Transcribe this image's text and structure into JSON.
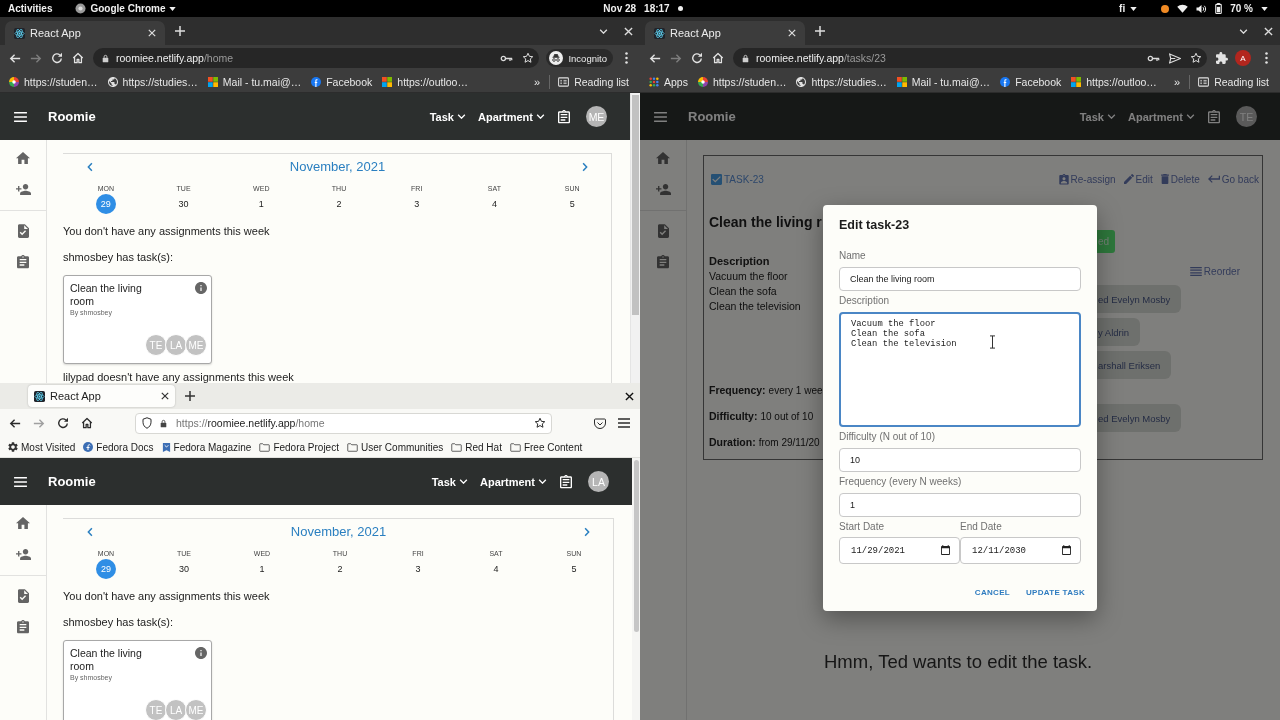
{
  "top_bar": {
    "activities": "Activities",
    "app_menu": "Google Chrome",
    "date": "Nov 28",
    "time": "18:17",
    "keyboard": "fi",
    "battery": "70 %"
  },
  "left_top_window": {
    "kind": "chrome",
    "tabs": [
      {
        "title": "React App",
        "selected": true
      }
    ],
    "url_host": "roomiee.netlify.app",
    "url_path": "/home",
    "omnibox_actions": [
      {
        "kind": "key"
      },
      {
        "kind": "star"
      }
    ],
    "toolbar_items": [
      {
        "kind": "incognito",
        "label": "Incognito"
      }
    ],
    "bookmarks": [
      {
        "kind": "pinwheel",
        "label": "https://studen…"
      },
      {
        "kind": "globe",
        "label": "https://studies…"
      },
      {
        "kind": "windows",
        "label": "Mail - tu.mai@…"
      },
      {
        "kind": "facebook",
        "label": "Facebook"
      },
      {
        "kind": "windows",
        "label": "https://outloo…"
      }
    ],
    "bookmark_overflow": "»",
    "reading_list": "Reading list",
    "page": {
      "kind": "home",
      "brand": "Roomie",
      "menus": [
        "Task",
        "Apartment"
      ],
      "avatar": "ME",
      "calendar": {
        "month": "November, 2021",
        "days": [
          {
            "weekday": "MON",
            "date": "29",
            "selected": true
          },
          {
            "weekday": "TUE",
            "date": "30",
            "selected": false
          },
          {
            "weekday": "WED",
            "date": "1",
            "selected": false
          },
          {
            "weekday": "THU",
            "date": "2",
            "selected": false
          },
          {
            "weekday": "FRI",
            "date": "3",
            "selected": false
          },
          {
            "weekday": "SAT",
            "date": "4",
            "selected": false
          },
          {
            "weekday": "SUN",
            "date": "5",
            "selected": false
          }
        ]
      },
      "note": "You don't have any assignments this week",
      "groups": [
        {
          "heading": "shmosbey has task(s):",
          "tasks": [
            {
              "title": "Clean the living room",
              "author": "By shmosbey",
              "assignees": [
                "TE",
                "LA",
                "ME"
              ]
            }
          ]
        }
      ],
      "trailing_note": "lilypad doesn't have any assignments this week"
    }
  },
  "left_bottom_window": {
    "kind": "firefox",
    "tabs": [
      {
        "title": "React App",
        "selected": true
      }
    ],
    "url_scheme": "https://",
    "url_host": "roomiee.netlify.app",
    "url_path": "/home",
    "bookmarks": [
      {
        "kind": "gear",
        "label": "Most Visited"
      },
      {
        "kind": "fedora",
        "label": "Fedora Docs"
      },
      {
        "kind": "magazine",
        "label": "Fedora Magazine"
      },
      {
        "kind": "folder",
        "label": "Fedora Project"
      },
      {
        "kind": "folder",
        "label": "User Communities"
      },
      {
        "kind": "folder",
        "label": "Red Hat"
      },
      {
        "kind": "folder",
        "label": "Free Content"
      }
    ],
    "page": {
      "kind": "home",
      "brand": "Roomie",
      "menus": [
        "Task",
        "Apartment"
      ],
      "avatar": "LA",
      "calendar": {
        "month": "November, 2021",
        "days": [
          {
            "weekday": "MON",
            "date": "29",
            "selected": true
          },
          {
            "weekday": "TUE",
            "date": "30",
            "selected": false
          },
          {
            "weekday": "WED",
            "date": "1",
            "selected": false
          },
          {
            "weekday": "THU",
            "date": "2",
            "selected": false
          },
          {
            "weekday": "FRI",
            "date": "3",
            "selected": false
          },
          {
            "weekday": "SAT",
            "date": "4",
            "selected": false
          },
          {
            "weekday": "SUN",
            "date": "5",
            "selected": false
          }
        ]
      },
      "note": "You don't have any assignments this week",
      "groups": [
        {
          "heading": "shmosbey has task(s):",
          "tasks": [
            {
              "title": "Clean the living room",
              "author": "By shmosbey",
              "assignees": [
                "TE",
                "LA",
                "ME"
              ]
            }
          ]
        }
      ]
    }
  },
  "right_window": {
    "kind": "chrome",
    "tabs": [
      {
        "title": "React App",
        "selected": true
      }
    ],
    "url_host": "roomiee.netlify.app",
    "url_path": "/tasks/23",
    "omnibox_actions": [
      {
        "kind": "key"
      },
      {
        "kind": "send"
      },
      {
        "kind": "star"
      }
    ],
    "toolbar_items": [
      {
        "kind": "extensions"
      },
      {
        "kind": "account",
        "initial": "A"
      }
    ],
    "bookmarks": [
      {
        "kind": "apps",
        "label": "Apps"
      },
      {
        "kind": "pinwheel",
        "label": "https://studen…"
      },
      {
        "kind": "globe",
        "label": "https://studies…"
      },
      {
        "kind": "windows",
        "label": "Mail - tu.mai@…"
      },
      {
        "kind": "facebook",
        "label": "Facebook"
      },
      {
        "kind": "windows",
        "label": "https://outloo…"
      }
    ],
    "bookmark_overflow": "»",
    "reading_list": "Reading list",
    "page": {
      "kind": "task",
      "dimmed": true,
      "brand": "Roomie",
      "menus": [
        "Task",
        "Apartment"
      ],
      "avatar": "TE",
      "task": {
        "id": "TASK-23",
        "actions": [
          {
            "kind": "assign",
            "label": "Re-assign"
          },
          {
            "kind": "edit",
            "label": "Edit"
          },
          {
            "kind": "delete",
            "label": "Delete"
          },
          {
            "kind": "back",
            "label": "Go back"
          }
        ],
        "title": "Clean the living r",
        "description_heading": "Description",
        "description_lines": [
          "Vacuum the floor",
          "Clean the sofa",
          "Clean the television"
        ],
        "facts": [
          {
            "label": "Frequency:",
            "value": "every 1 wee"
          },
          {
            "label": "Difficulty:",
            "value": "10 out of 10"
          },
          {
            "label": "Duration:",
            "value": "from 29/11/20"
          }
        ],
        "status_button": "ed",
        "reorder": "Reorder",
        "assignment_groups": [
          [
            "ed Evelyn Mosby",
            "y Aldrin",
            "arshall Eriksen"
          ],
          [
            "ed Evelyn Mosby"
          ]
        ]
      }
    },
    "dialog": {
      "title": "Edit task-23",
      "fields": [
        {
          "kind": "text",
          "label": "Name",
          "value": "Clean the living room"
        },
        {
          "kind": "textarea",
          "label": "Description",
          "value": "Vacuum the floor\nClean the sofa\nClean the television",
          "focused": true,
          "pointer_over": true
        },
        {
          "kind": "text",
          "label": "Difficulty (N out of 10)",
          "value": "10"
        },
        {
          "kind": "text",
          "label": "Frequency (every N weeks)",
          "value": "1"
        }
      ],
      "date_fields": [
        {
          "label": "Start Date",
          "value": "11/29/2021"
        },
        {
          "label": "End Date",
          "value": "12/11/2030"
        }
      ],
      "buttons": [
        "CANCEL",
        "UPDATE TASK"
      ]
    },
    "caption": "Hmm, Ted wants to edit the task."
  }
}
